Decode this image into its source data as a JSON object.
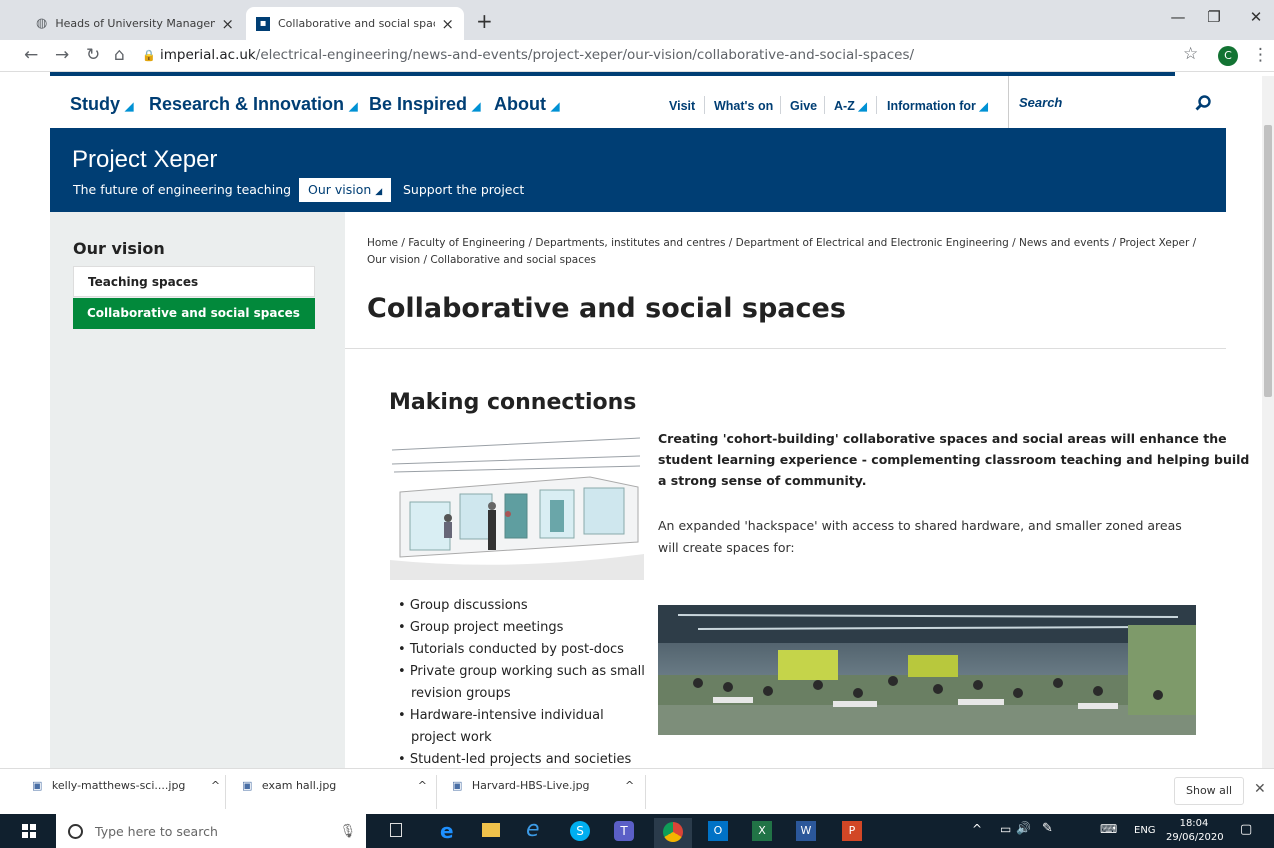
{
  "browser": {
    "tabs": [
      {
        "title": "Heads of University Managemen",
        "active": false
      },
      {
        "title": "Collaborative and social spaces |",
        "active": true
      }
    ],
    "url_domain": "imperial.ac.uk",
    "url_path": "/electrical-engineering/news-and-events/project-xeper/our-vision/collaborative-and-social-spaces/",
    "profile_initial": "C"
  },
  "site_nav": {
    "main": [
      "Study",
      "Research & Innovation",
      "Be Inspired",
      "About"
    ],
    "secondary": [
      "Visit",
      "What's on",
      "Give",
      "A-Z",
      "Information for"
    ],
    "search_placeholder": "Search"
  },
  "banner": {
    "title": "Project Xeper",
    "links": [
      "The future of engineering teaching",
      "Our vision",
      "Support the project"
    ]
  },
  "sidebar": {
    "heading": "Our vision",
    "items": [
      "Teaching spaces",
      "Collaborative and social spaces"
    ]
  },
  "breadcrumb": {
    "line1": "Home /  Faculty of Engineering /  Departments, institutes and centres /  Department of Electrical and Electronic Engineering /  News and events /  Project Xeper /",
    "line2": "Our vision /  Collaborative and social spaces"
  },
  "page": {
    "title": "Collaborative and social spaces",
    "section_heading": "Making connections",
    "lead_line1": "Creating 'cohort-building' collaborative spaces and social areas will enhance the",
    "lead_line2": "student learning experience - complementing classroom teaching and helping build",
    "lead_line3": "a strong sense of community.",
    "para_line1": "An expanded 'hackspace' with access to shared hardware, and smaller zoned areas",
    "para_line2": "will create spaces for:",
    "bullets": [
      "Group discussions",
      "Group project meetings",
      "Tutorials conducted by post-docs",
      "Private group working such as small",
      "revision groups",
      "Hardware-intensive individual",
      "project work",
      "Student-led projects and societies"
    ]
  },
  "downloads": {
    "items": [
      "kelly-matthews-sci....jpg",
      "exam hall.jpg",
      "Harvard-HBS-Live.jpg"
    ],
    "show_all": "Show all"
  },
  "taskbar": {
    "search_placeholder": "Type here to search",
    "lang": "ENG",
    "time": "18:04",
    "date": "29/06/2020"
  },
  "colors": {
    "imperial_navy": "#003e74",
    "active_green": "#02893b",
    "accent_blue": "#0091d4"
  }
}
